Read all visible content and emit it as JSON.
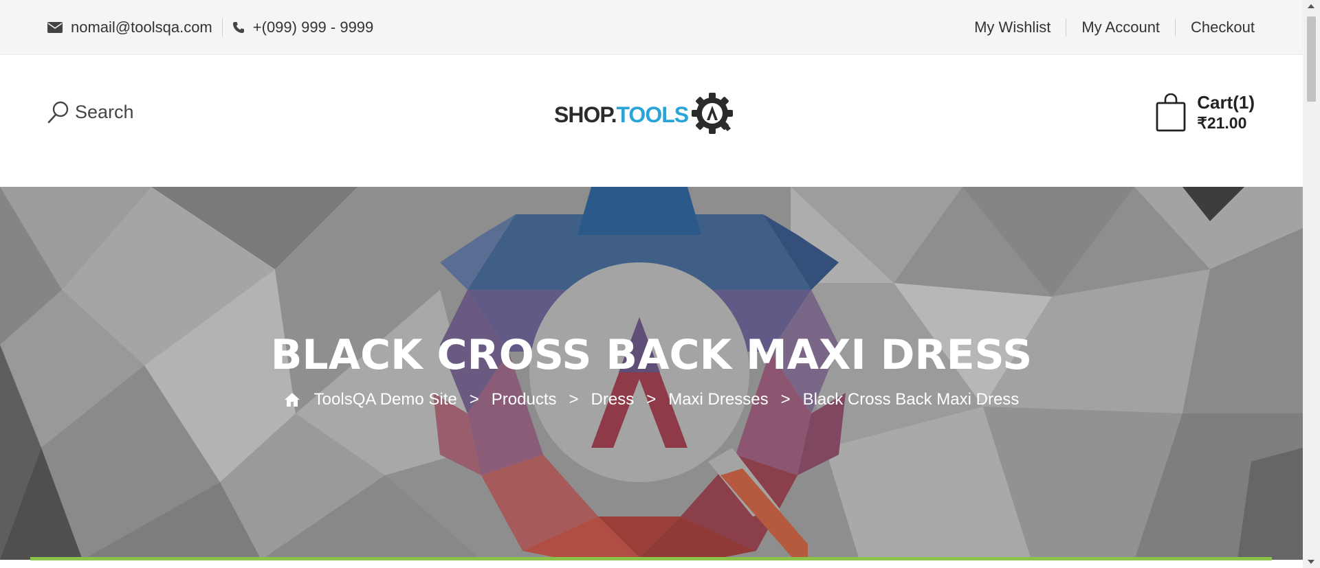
{
  "topbar": {
    "email": "nomail@toolsqa.com",
    "phone": "+(099) 999 - 9999",
    "links": [
      "My Wishlist",
      "My Account",
      "Checkout"
    ]
  },
  "header": {
    "search_label": "Search",
    "logo": {
      "part1": "SHOP.",
      "part2": "TOOLS"
    },
    "cart_label": "Cart(1)",
    "cart_total": "₹21.00"
  },
  "hero": {
    "title": "BLACK CROSS BACK MAXI DRESS",
    "breadcrumb": [
      "ToolsQA Demo Site",
      "Products",
      "Dress",
      "Maxi Dresses",
      "Black Cross Back Maxi Dress"
    ],
    "separator": ">"
  },
  "colors": {
    "accent": "#2aa3d8",
    "green_line": "#8bc34a",
    "topbar_bg": "#f5f5f5"
  },
  "icons": [
    "envelope-icon",
    "phone-icon",
    "search-icon",
    "shopping-bag-icon",
    "home-icon",
    "gear-logo-icon"
  ]
}
